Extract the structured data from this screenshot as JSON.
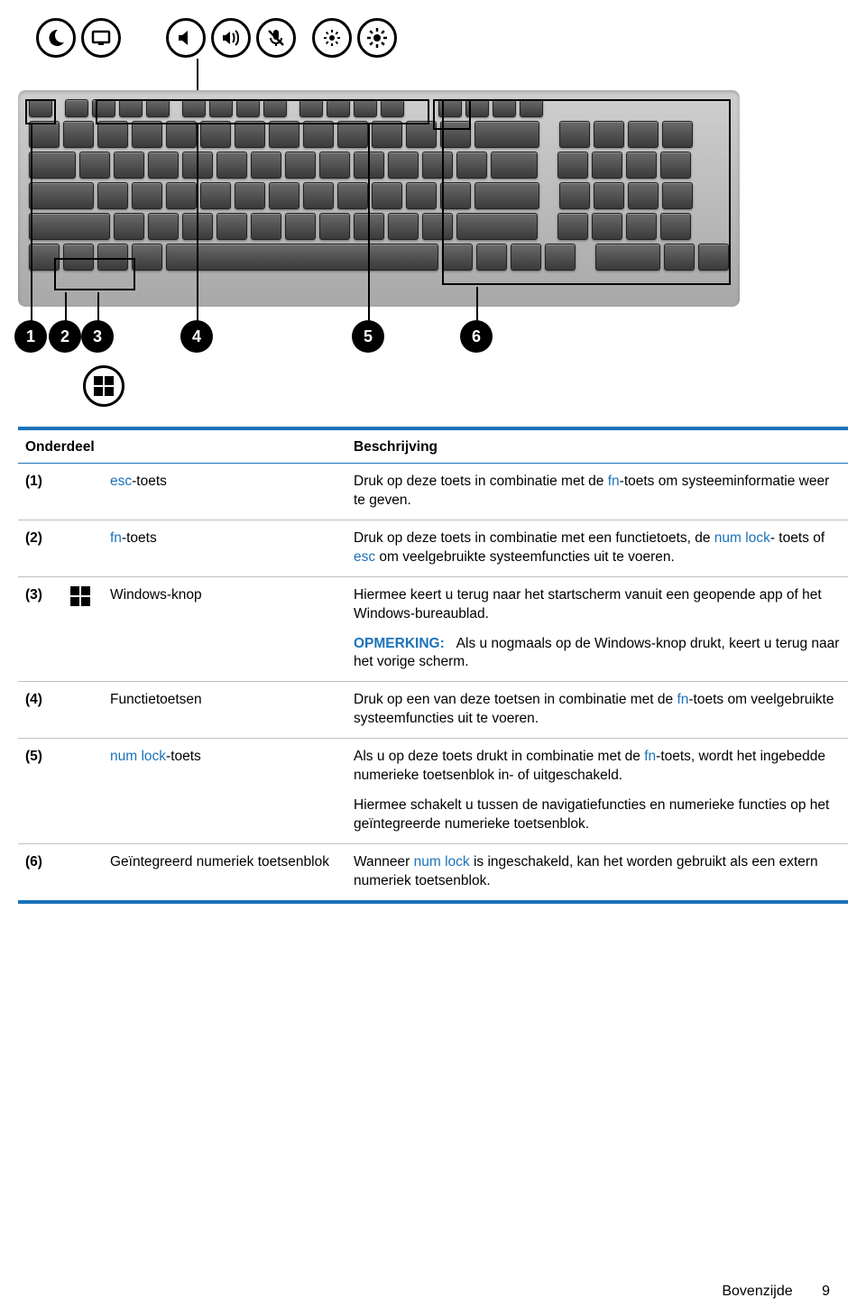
{
  "figure": {
    "top_icons": [
      "moon",
      "monitor",
      "speaker-mute",
      "speaker-loud",
      "mic-mute",
      "brightness-low",
      "brightness-high"
    ],
    "markers": [
      "1",
      "2",
      "3",
      "4",
      "5",
      "6"
    ]
  },
  "table": {
    "headers": {
      "col1": "Onderdeel",
      "col2": "",
      "col3": "Beschrijving"
    },
    "rows": [
      {
        "num": "(1)",
        "name_pre": "",
        "name_kw": "esc",
        "name_post": "-toets",
        "desc": [
          {
            "parts": [
              {
                "t": "Druk op deze toets in combinatie met de "
              },
              {
                "t": "fn",
                "kw": true
              },
              {
                "t": "-toets om systeeminformatie weer te geven."
              }
            ]
          }
        ]
      },
      {
        "num": "(2)",
        "name_pre": "",
        "name_kw": "fn",
        "name_post": "-toets",
        "desc": [
          {
            "parts": [
              {
                "t": "Druk op deze toets in combinatie met een functietoets, de "
              },
              {
                "t": "num lock",
                "kw": true
              },
              {
                "t": "- toets of "
              },
              {
                "t": "esc",
                "kw": true
              },
              {
                "t": " om veelgebruikte systeemfuncties uit te voeren."
              }
            ]
          }
        ]
      },
      {
        "num": "(3)",
        "icon": "windows",
        "name_plain": "Windows-knop",
        "desc": [
          {
            "parts": [
              {
                "t": "Hiermee keert u terug naar het startscherm vanuit een geopende app of het Windows-bureaublad."
              }
            ]
          },
          {
            "note": true,
            "label": "OPMERKING:",
            "parts": [
              {
                "t": "Als u nogmaals op de Windows-knop drukt, keert u terug naar het vorige scherm."
              }
            ]
          }
        ]
      },
      {
        "num": "(4)",
        "name_plain": "Functietoetsen",
        "desc": [
          {
            "parts": [
              {
                "t": "Druk op een van deze toetsen in combinatie met de "
              },
              {
                "t": "fn",
                "kw": true
              },
              {
                "t": "-toets om veelgebruikte systeemfuncties uit te voeren."
              }
            ]
          }
        ]
      },
      {
        "num": "(5)",
        "name_pre": "",
        "name_kw": "num lock",
        "name_post": "-toets",
        "desc": [
          {
            "parts": [
              {
                "t": "Als u op deze toets drukt in combinatie met de "
              },
              {
                "t": "fn",
                "kw": true
              },
              {
                "t": "-toets, wordt het ingebedde numerieke toetsenblok in- of uitgeschakeld."
              }
            ]
          },
          {
            "parts": [
              {
                "t": "Hiermee schakelt u tussen de navigatiefuncties en numerieke functies op het geïntegreerde numerieke toetsenblok."
              }
            ]
          }
        ]
      },
      {
        "num": "(6)",
        "name_plain": "Geïntegreerd numeriek toetsenblok",
        "desc": [
          {
            "parts": [
              {
                "t": "Wanneer "
              },
              {
                "t": "num lock",
                "kw": true
              },
              {
                "t": " is ingeschakeld, kan het worden gebruikt als een extern numeriek toetsenblok."
              }
            ]
          }
        ]
      }
    ]
  },
  "footer": {
    "section": "Bovenzijde",
    "page": "9"
  }
}
